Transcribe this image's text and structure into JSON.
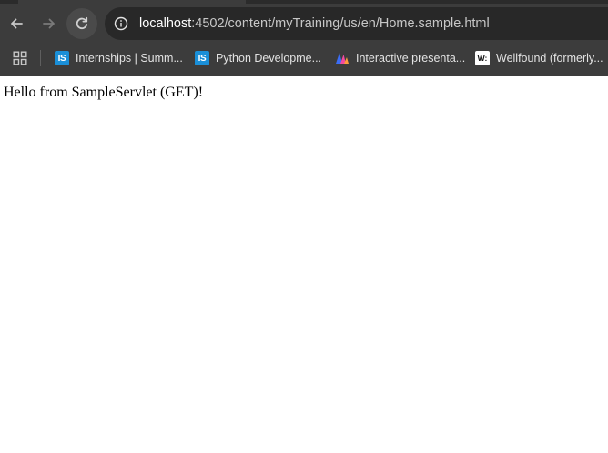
{
  "browser": {
    "url_host": "localhost",
    "url_rest": ":4502/content/myTraining/us/en/Home.sample.html",
    "back_icon": "arrow-left-icon",
    "forward_icon": "arrow-right-icon",
    "reload_icon": "reload-icon",
    "site_info_icon": "info-icon"
  },
  "bookmarks": {
    "apps_icon": "apps-grid-icon",
    "items": [
      {
        "label": "Internships | Summ...",
        "icon": "internshala-icon",
        "icon_text": "IS"
      },
      {
        "label": "Python Developme...",
        "icon": "internshala-icon",
        "icon_text": "IS"
      },
      {
        "label": "Interactive presenta...",
        "icon": "mentimeter-icon"
      },
      {
        "label": "Wellfound (formerly...",
        "icon": "wellfound-icon",
        "icon_text": "W:"
      }
    ]
  },
  "page": {
    "text": "Hello from SampleServlet (GET)!"
  },
  "colors": {
    "chrome": "#3c3c3c",
    "omnibox": "#282828",
    "internshala": "#1a8fd8"
  }
}
